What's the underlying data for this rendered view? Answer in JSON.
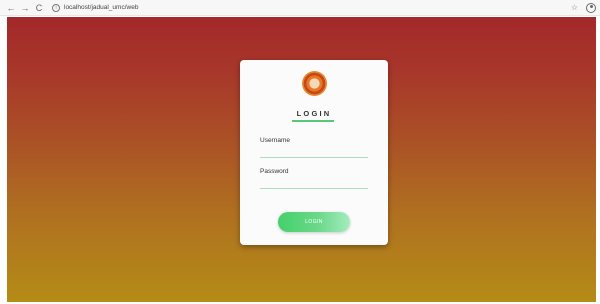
{
  "browser": {
    "back_glyph": "←",
    "forward_glyph": "→",
    "reload_glyph": "C",
    "info_glyph": "i",
    "url": "localhost/jadual_umc/web",
    "star_glyph": "☆"
  },
  "login": {
    "title": "LOGIN",
    "username_label": "Username",
    "password_label": "Password",
    "button_label": "LOGIN",
    "username_value": "",
    "password_value": ""
  },
  "colors": {
    "gradient_top": "#a3282a",
    "gradient_bottom": "#b48c16",
    "accent_green": "#58c878"
  },
  "icons": [
    "back-arrow-icon",
    "forward-arrow-icon",
    "reload-icon",
    "info-icon",
    "star-icon",
    "account-icon",
    "logo-icon"
  ]
}
